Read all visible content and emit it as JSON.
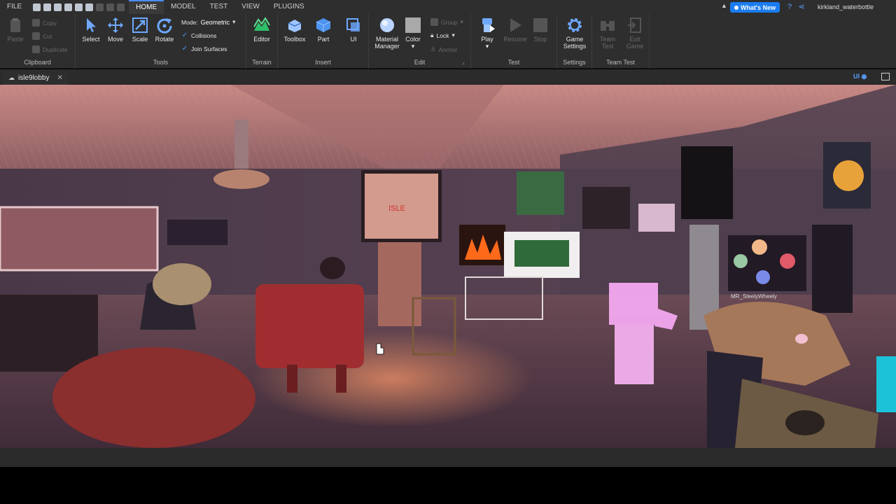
{
  "menubar": {
    "file": "FILE",
    "tabs": [
      {
        "label": "HOME",
        "active": true
      },
      {
        "label": "MODEL",
        "active": false
      },
      {
        "label": "TEST",
        "active": false
      },
      {
        "label": "VIEW",
        "active": false
      },
      {
        "label": "PLUGINS",
        "active": false
      }
    ],
    "whats_new": "What's New",
    "username": "kirkland_waterbottle"
  },
  "ribbon": {
    "clipboard": {
      "label": "Clipboard",
      "paste": "Paste",
      "copy": "Copy",
      "cut": "Cut",
      "duplicate": "Duplicate"
    },
    "tools": {
      "label": "Tools",
      "select": "Select",
      "move": "Move",
      "scale": "Scale",
      "rotate": "Rotate",
      "mode_label": "Mode:",
      "mode_value": "Geometric",
      "collisions": "Collisions",
      "join_surfaces": "Join Surfaces"
    },
    "terrain": {
      "label": "Terrain",
      "editor": "Editor"
    },
    "insert": {
      "label": "Insert",
      "toolbox": "Toolbox",
      "part": "Part",
      "ui": "UI"
    },
    "edit": {
      "label": "Edit",
      "material_manager_1": "Material",
      "material_manager_2": "Manager",
      "color": "Color",
      "group": "Group",
      "lock": "Lock",
      "anchor": "Anchor"
    },
    "test": {
      "label": "Test",
      "play": "Play",
      "resume": "Resume",
      "stop": "Stop"
    },
    "settings": {
      "label": "Settings",
      "game_settings_1": "Game",
      "game_settings_2": "Settings"
    },
    "team_test": {
      "label": "Team Test",
      "team_test_1": "Team",
      "team_test_2": "Test",
      "exit_game_1": "Exit",
      "exit_game_2": "Game"
    }
  },
  "tabbar": {
    "document": "isle9lobby",
    "ui_toggle": "UI"
  },
  "scene": {
    "tv_text": "ISLE",
    "poster_caption": "MR_SteelyWheely"
  },
  "colors": {
    "accent": "#1a7cf0",
    "chrome_bg": "#2e2e2e",
    "tv_text": "#d0302c"
  }
}
